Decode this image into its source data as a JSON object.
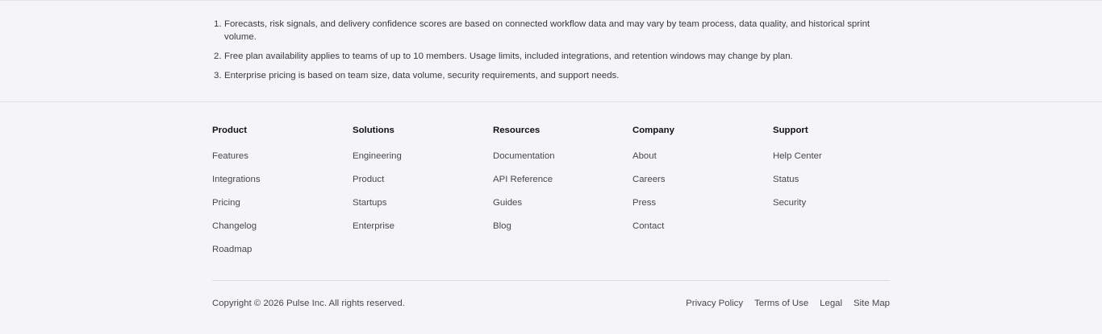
{
  "footnotes": [
    {
      "num": "1.",
      "text": "Forecasts, risk signals, and delivery confidence scores are based on connected workflow data and may vary by team process, data quality, and historical sprint volume."
    },
    {
      "num": "2.",
      "text": "Free plan availability applies to teams of up to 10 members. Usage limits, included integrations, and retention windows may change by plan."
    },
    {
      "num": "3.",
      "text": "Enterprise pricing is based on team size, data volume, security requirements, and support needs."
    }
  ],
  "footer": {
    "columns": [
      {
        "heading": "Product",
        "links": [
          "Features",
          "Integrations",
          "Pricing",
          "Changelog",
          "Roadmap"
        ]
      },
      {
        "heading": "Solutions",
        "links": [
          "Engineering",
          "Product",
          "Startups",
          "Enterprise"
        ]
      },
      {
        "heading": "Resources",
        "links": [
          "Documentation",
          "API Reference",
          "Guides",
          "Blog"
        ]
      },
      {
        "heading": "Company",
        "links": [
          "About",
          "Careers",
          "Press",
          "Contact"
        ]
      },
      {
        "heading": "Support",
        "links": [
          "Help Center",
          "Status",
          "Security"
        ]
      }
    ],
    "copyright": "Copyright © 2026 Pulse Inc. All rights reserved.",
    "legal_links": [
      "Privacy Policy",
      "Terms of Use",
      "Legal",
      "Site Map"
    ]
  }
}
